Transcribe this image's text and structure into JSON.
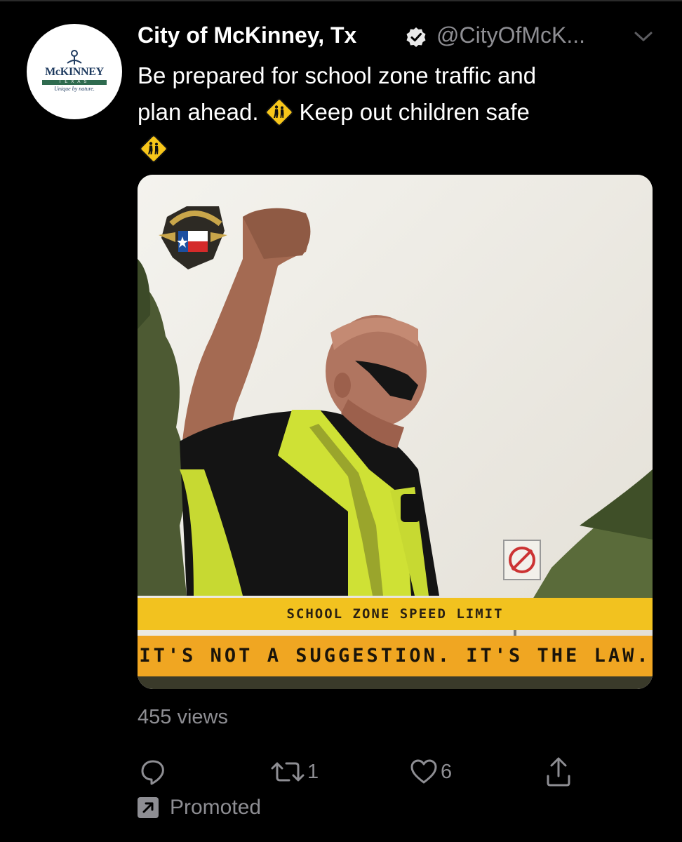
{
  "account": {
    "name": "City of McKinney, Tx",
    "handle": "@CityOfMcK...",
    "verified": true,
    "avatar_logo": {
      "wordmark": "McKINNEY",
      "state": "TEXAS",
      "tagline": "Unique by nature."
    }
  },
  "tweet": {
    "line1": "Be prepared for school zone traffic and",
    "line2_a": "plan ahead.",
    "line2_b": "Keep out children safe",
    "emoji": "school-crossing-sign-icon"
  },
  "media": {
    "type": "video-still",
    "badge": "POLICE",
    "banner_top": "SCHOOL ZONE SPEED LIMIT",
    "banner_bottom": "IT'S NOT A SUGGESTION. IT'S THE LAW."
  },
  "stats": {
    "views": "455 views"
  },
  "actions": {
    "reply_icon": "reply-icon",
    "retweet_count": "1",
    "like_count": "6",
    "share_icon": "share-icon"
  },
  "promoted": {
    "label": "Promoted"
  },
  "colors": {
    "background": "#000000",
    "text": "#ffffff",
    "secondary": "#8e8e93",
    "banner_yellow": "#f2c21f",
    "banner_orange": "#f0a622",
    "sign_yellow": "#f7c61a"
  }
}
